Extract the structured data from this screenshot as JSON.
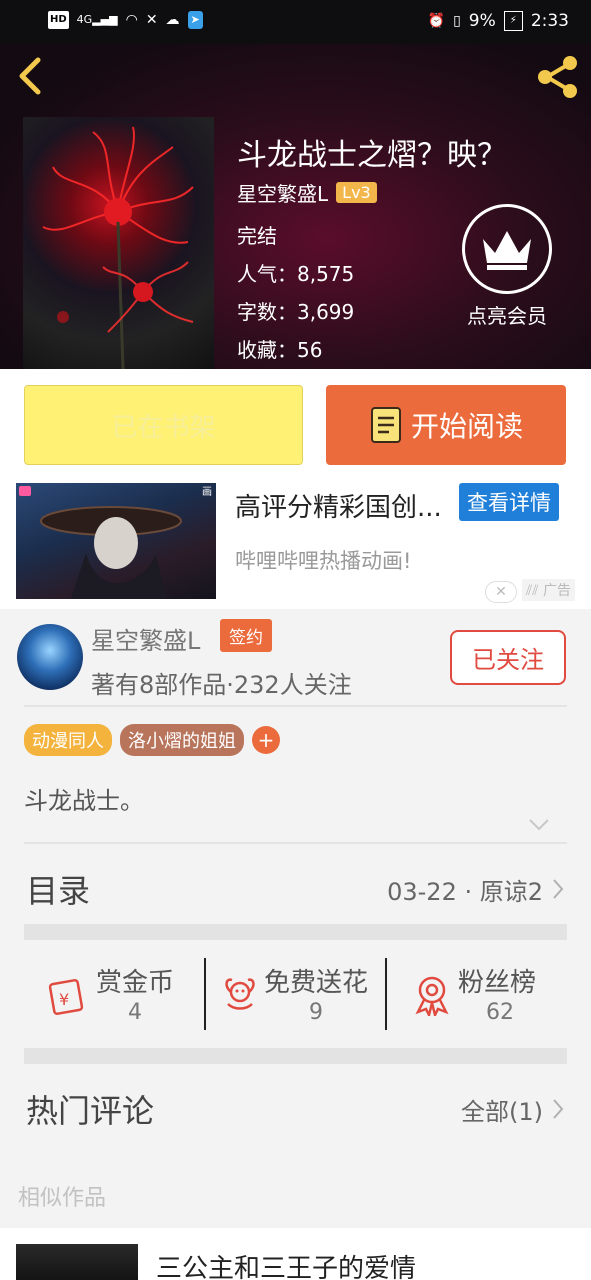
{
  "status_bar": {
    "network": "HD",
    "signal": "4G",
    "battery": "9%",
    "time": "2:33"
  },
  "book": {
    "title": "斗龙战士之熠？映？",
    "author": "星空繁盛L",
    "author_level": "Lv3",
    "status": "完结",
    "popularity": "人气：8,575",
    "word_count": "字数：3,699",
    "favorites": "收藏：56"
  },
  "vip": {
    "label": "点亮会员"
  },
  "actions": {
    "shelf_label": "已在书架",
    "read_label": "开始阅读"
  },
  "ad": {
    "title": "高评分精彩国创...",
    "detail_button": "查看详情",
    "subtitle": "哔哩哔哩热播动画!",
    "ad_tag": "广告"
  },
  "author_card": {
    "name": "星空繁盛L",
    "sign_badge": "签约",
    "stats": "著有8部作品·232人关注",
    "follow_button": "已关注"
  },
  "tags": [
    {
      "label": "动漫同人",
      "color": "#f3b33d"
    },
    {
      "label": "洛小熠的姐姐",
      "color": "#b8755c"
    }
  ],
  "summary": "斗龙战士。",
  "toc": {
    "label": "目录",
    "latest": "03-22 · 原谅2"
  },
  "stats": [
    {
      "label": "赏金币",
      "value": "4",
      "icon": "red-envelope-icon"
    },
    {
      "label": "免费送花",
      "value": "9",
      "icon": "flower-icon"
    },
    {
      "label": "粉丝榜",
      "value": "62",
      "icon": "award-ribbon-icon"
    }
  ],
  "hot_comments": {
    "label": "热门评论",
    "all": "全部(1)"
  },
  "similar": {
    "label": "相似作品",
    "items": [
      {
        "title": "三公主和三王子的爱情"
      }
    ]
  },
  "colors": {
    "accent": "#ec6b3d",
    "shelf_yellow": "#fff173",
    "follow_red": "#e04a3f",
    "ad_blue": "#1f7fd9"
  }
}
